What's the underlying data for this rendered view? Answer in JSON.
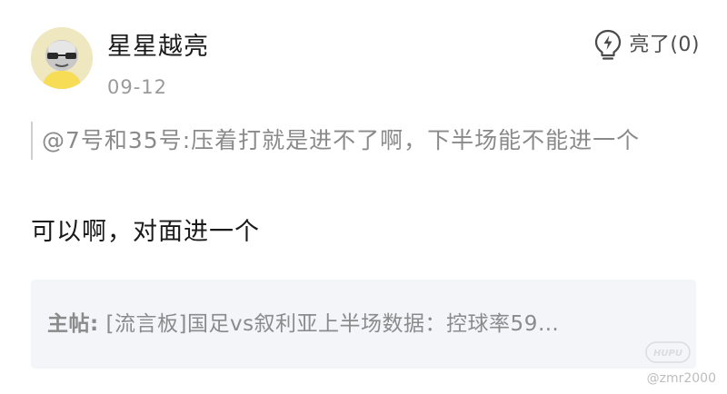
{
  "user": {
    "name": "星星越亮",
    "date": "09-12"
  },
  "like": {
    "label": "亮了(0)",
    "icon": "lightning-bulb-icon"
  },
  "quote": {
    "text": "@7号和35号:压着打就是进不了啊，下半场能不能进一个"
  },
  "reply": {
    "text": "可以啊，对面进一个"
  },
  "main_post": {
    "tag": "主帖:",
    "text": "[流言板]国足vs叙利亚上半场数据：控球率59…"
  },
  "watermark": {
    "logo_text": "HUPU",
    "handle": "@zmr2000"
  }
}
